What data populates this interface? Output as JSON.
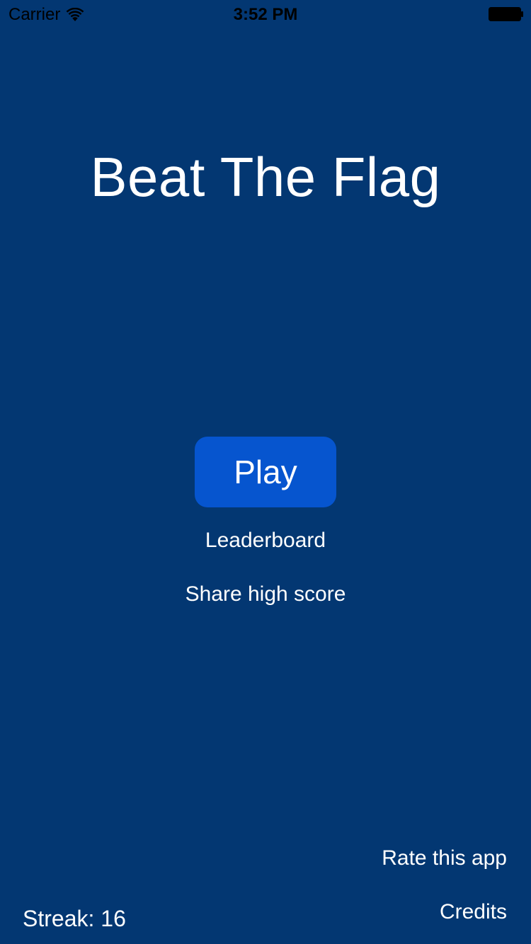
{
  "status_bar": {
    "carrier": "Carrier",
    "time": "3:52 PM",
    "wifi_icon": "wifi-icon",
    "battery_icon": "battery-icon"
  },
  "title": "Beat The Flag",
  "menu": {
    "play_label": "Play",
    "leaderboard_label": "Leaderboard",
    "share_label": "Share high score"
  },
  "footer": {
    "rate_label": "Rate this app",
    "credits_label": "Credits",
    "streak_text": "Streak: 16"
  },
  "colors": {
    "background": "#033772",
    "play_button": "#0655CF",
    "text": "#FFFFFF"
  }
}
